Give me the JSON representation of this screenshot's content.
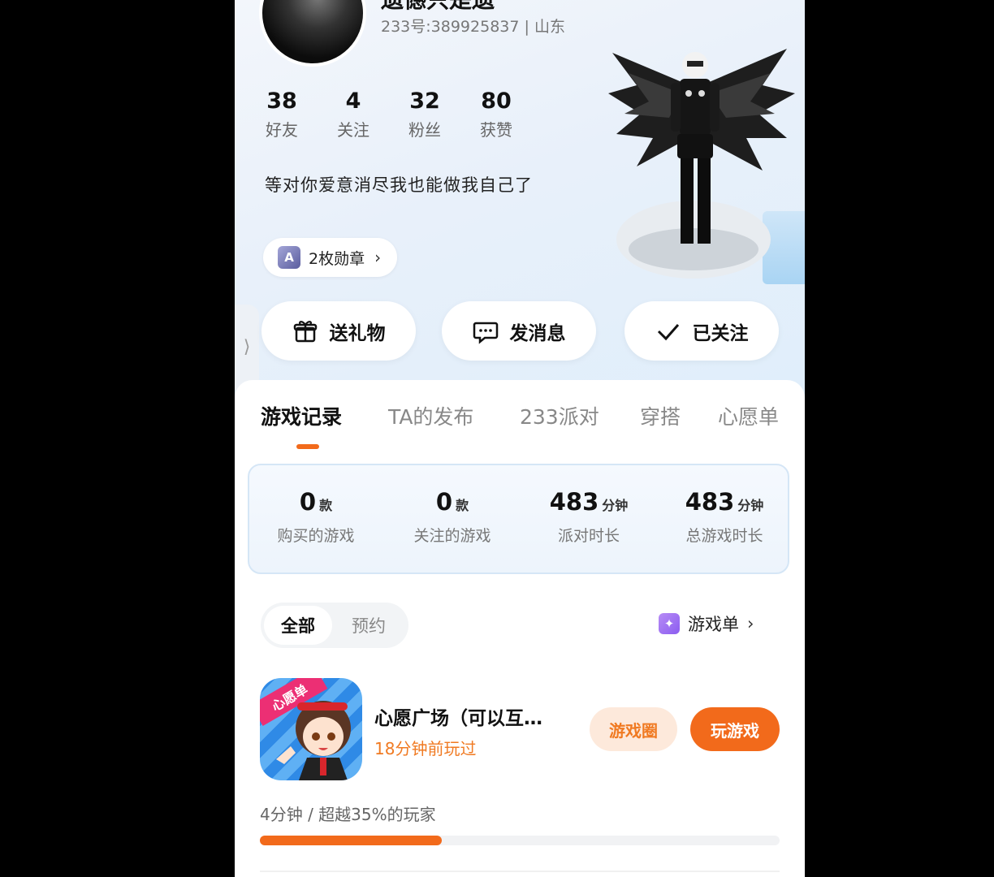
{
  "profile": {
    "name": "遗憾只是遗",
    "id_line": "233号:389925837 | 山东",
    "stats": [
      {
        "value": "38",
        "label": "好友"
      },
      {
        "value": "4",
        "label": "关注"
      },
      {
        "value": "32",
        "label": "粉丝"
      },
      {
        "value": "80",
        "label": "获赞"
      }
    ],
    "bio": "等对你爱意消尽我也能做我自己了",
    "medal_label": "2枚勋章"
  },
  "actions": {
    "gift": "送礼物",
    "message": "发消息",
    "followed": "已关注"
  },
  "tabs": [
    "游戏记录",
    "TA的发布",
    "233派对",
    "穿搭",
    "心愿单"
  ],
  "game_stats": [
    {
      "value": "0",
      "unit": "款",
      "label": "购买的游戏"
    },
    {
      "value": "0",
      "unit": "款",
      "label": "关注的游戏"
    },
    {
      "value": "483",
      "unit": "分钟",
      "label": "派对时长"
    },
    {
      "value": "483",
      "unit": "分钟",
      "label": "总游戏时长"
    }
  ],
  "filter": {
    "all": "全部",
    "reserve": "预约"
  },
  "game_list_label": "游戏单",
  "game": {
    "icon_tag": "心愿单",
    "title": "心愿广场（可以互…",
    "last_played": "18分钟前玩过",
    "circle_button": "游戏圈",
    "play_button": "玩游戏",
    "summary": "4分钟 / 超越35%的玩家",
    "progress": 0.35
  },
  "colors": {
    "accent": "#f26a1b",
    "stats_border": "#d5e6f6"
  }
}
